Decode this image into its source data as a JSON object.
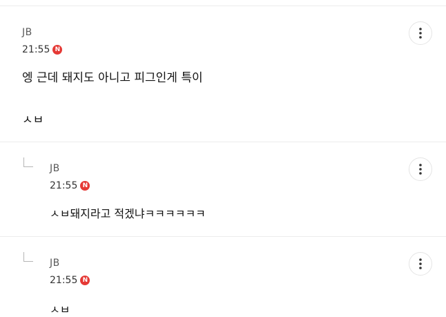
{
  "comments": [
    {
      "author": "JB",
      "time": "21:55",
      "badge": "N",
      "lines": [
        "엥 근데 돼지도 아니고 피그인게 특이",
        "ㅅㅂ"
      ],
      "is_reply": false
    },
    {
      "author": "JB",
      "time": "21:55",
      "badge": "N",
      "lines": [
        "ㅅㅂ돼지라고 적겠냐ㅋㅋㅋㅋㅋㅋ"
      ],
      "is_reply": true
    },
    {
      "author": "JB",
      "time": "21:55",
      "badge": "N",
      "lines": [
        "ㅅㅂ"
      ],
      "is_reply": true
    }
  ],
  "colors": {
    "badge": "#e53935",
    "divider": "#ececec"
  },
  "icons": {
    "more": "more-vertical-icon",
    "reply": "reply-arrow-icon",
    "new": "new-badge-icon"
  }
}
